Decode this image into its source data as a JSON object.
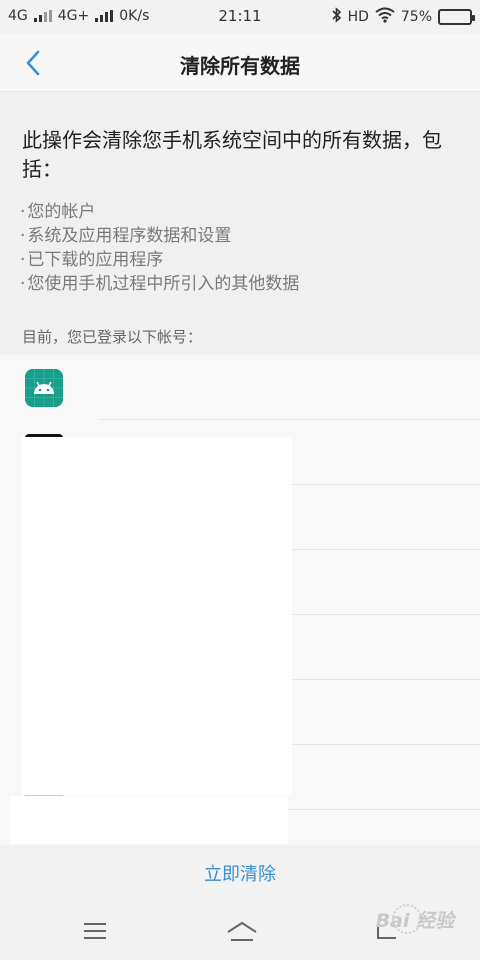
{
  "status_bar": {
    "sim1": "4G",
    "sim2": "4G+",
    "speed": "0K/s",
    "time": "21:11",
    "hd_label": "HD",
    "battery_text": "75%",
    "battery_level": 0.75
  },
  "header": {
    "title": "清除所有数据"
  },
  "description": {
    "heading": "此操作会清除您手机系统空间中的所有数据，包括：",
    "items": [
      "您的帐户",
      "系统及应用程序数据和设置",
      "已下载的应用程序",
      "您使用手机过程中所引入的其他数据"
    ],
    "accounts_label": "目前，您已登录以下帐号："
  },
  "actions": {
    "clear_now": "立即清除"
  },
  "watermark": {
    "text": "Bai 经验"
  },
  "colors": {
    "accent": "#3a8fd1",
    "android_icon": "#1a9e8a"
  },
  "icons": {
    "back": "chevron-left-icon",
    "menu": "menu-icon",
    "home": "home-icon",
    "back_nav": "back-nav-icon"
  }
}
